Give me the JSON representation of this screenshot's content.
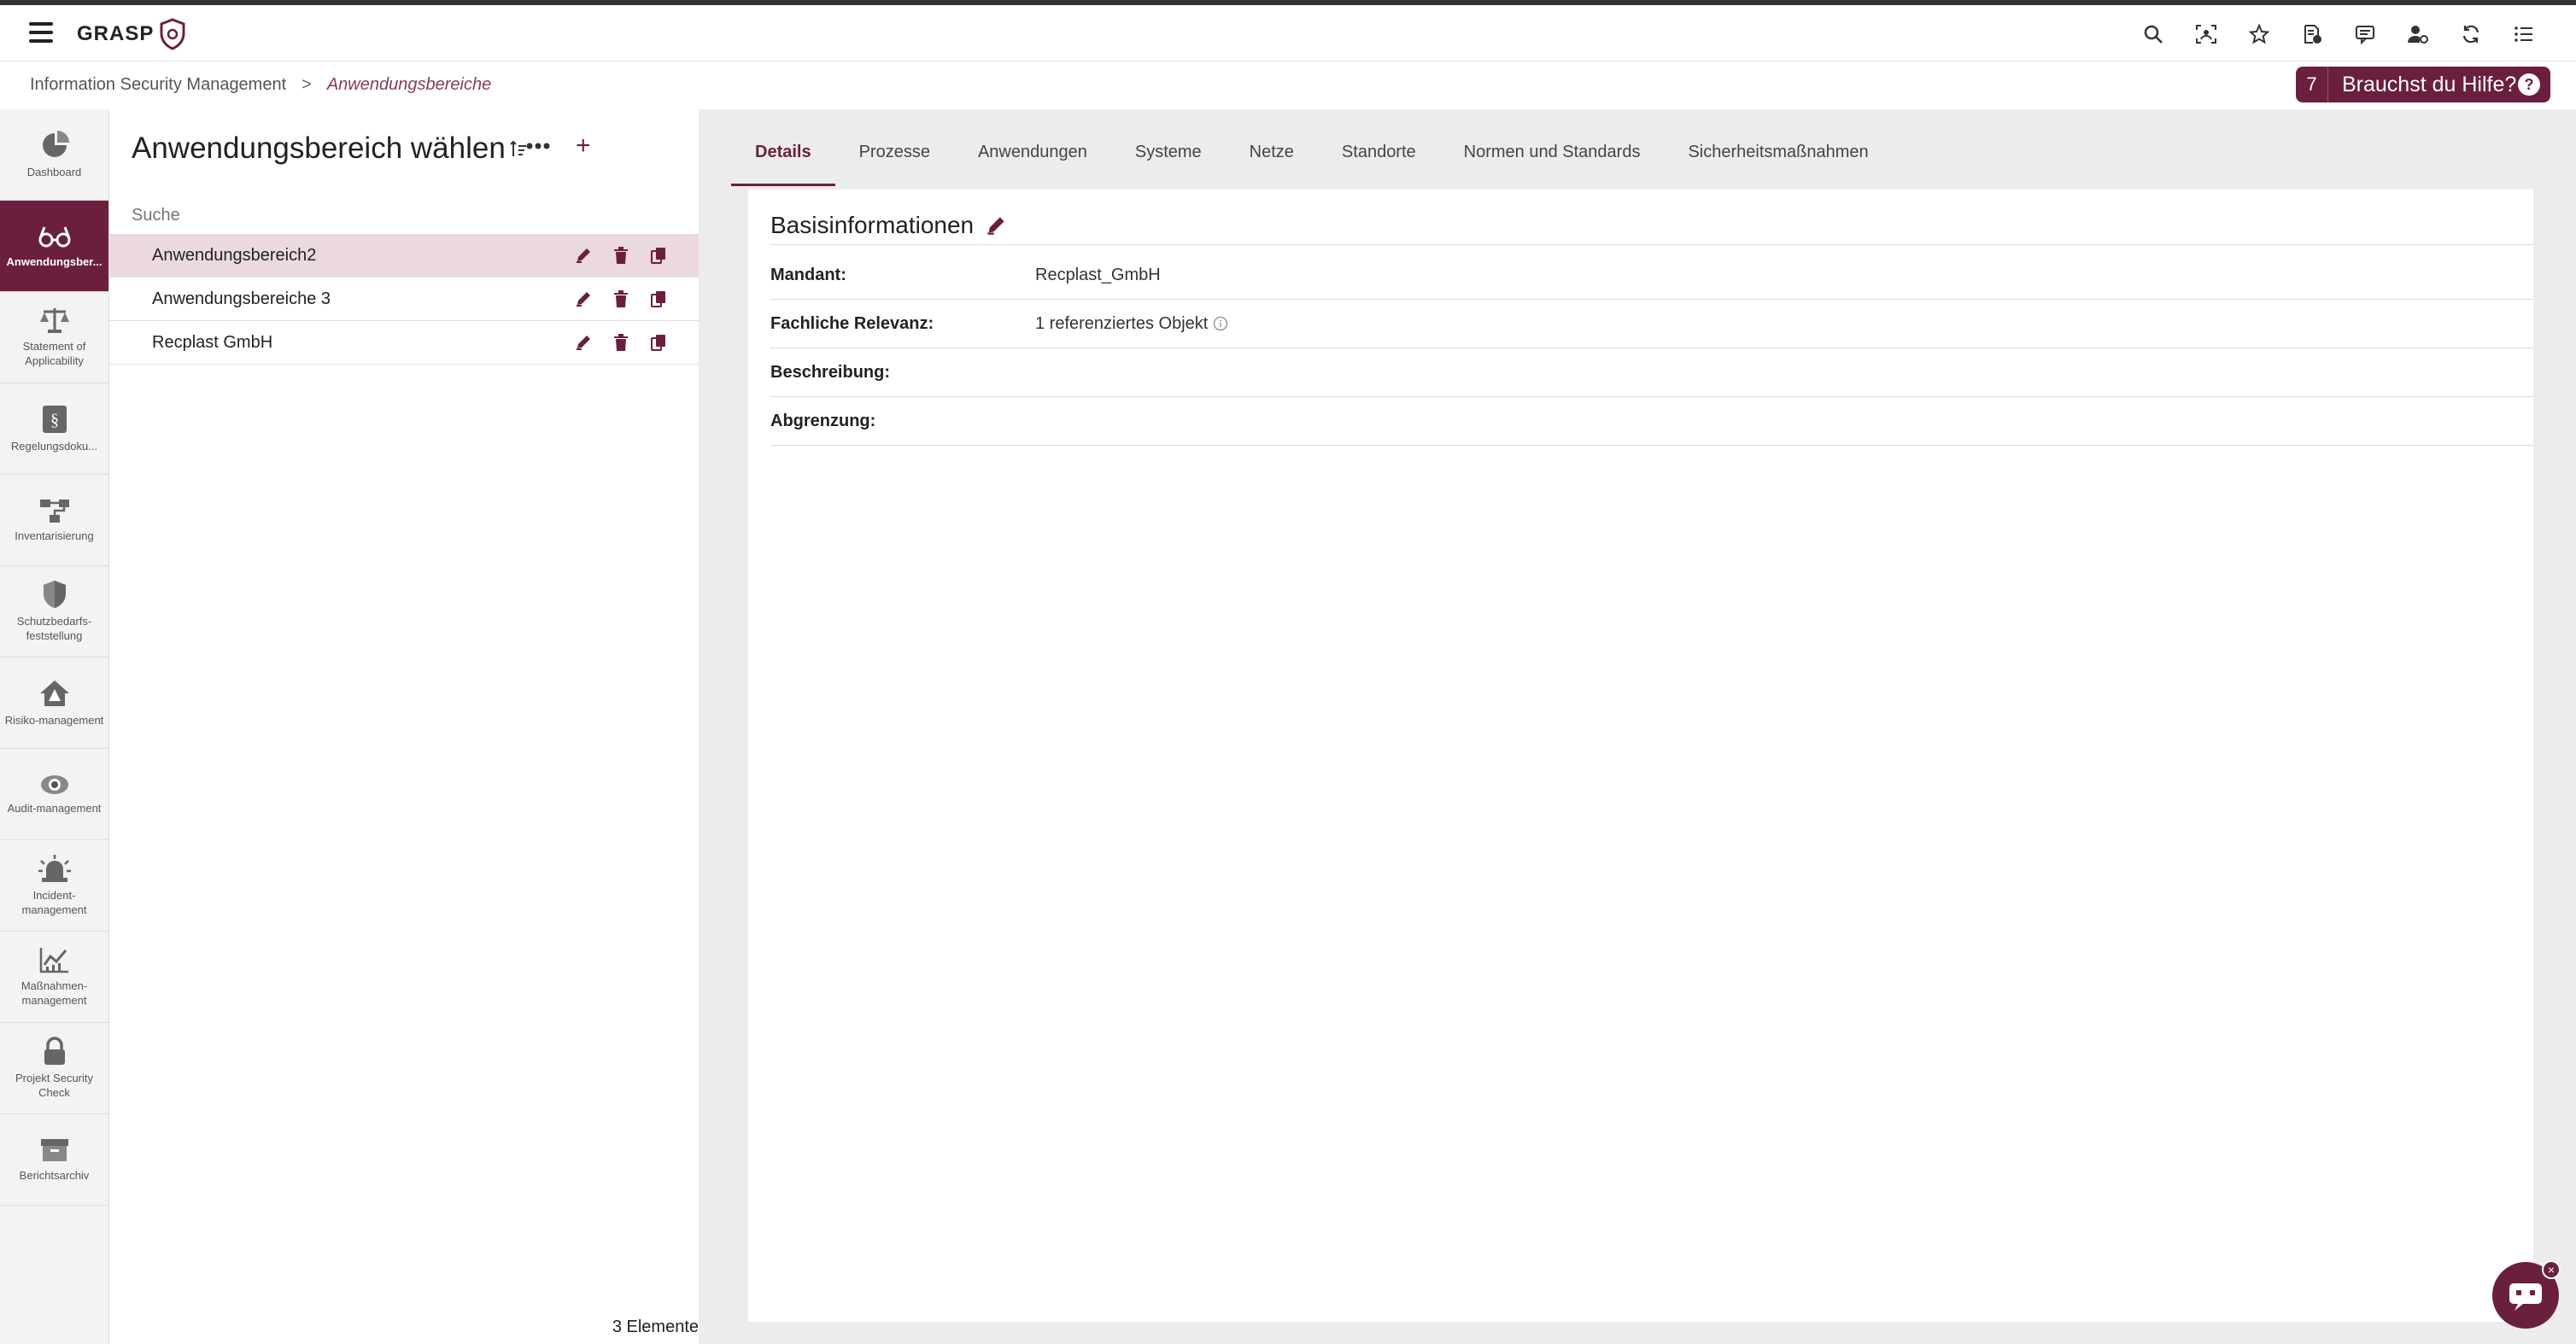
{
  "app": {
    "name": "GRASP"
  },
  "topbar": {
    "icons": [
      "search-icon",
      "face-scan-icon",
      "star-icon",
      "document-info-icon",
      "chat-icon",
      "user-settings-icon",
      "sync-icon",
      "list-icon"
    ]
  },
  "breadcrumb": {
    "root": "Information Security Management",
    "separator": ">",
    "current": "Anwendungsbereiche"
  },
  "help": {
    "count": "7",
    "label": "Brauchst du Hilfe?"
  },
  "sidebar": {
    "items": [
      {
        "label": "Dashboard",
        "icon": "pie-chart-icon"
      },
      {
        "label": "Anwendungsber...",
        "icon": "glasses-icon",
        "active": true
      },
      {
        "label": "Statement of Applicability",
        "icon": "scales-icon"
      },
      {
        "label": "Regelungsdoku...",
        "icon": "paragraph-icon"
      },
      {
        "label": "Inventarisierung",
        "icon": "network-icon"
      },
      {
        "label": "Schutzbedarfs-feststellung",
        "icon": "shield-icon"
      },
      {
        "label": "Risiko-management",
        "icon": "house-risk-icon"
      },
      {
        "label": "Audit-management",
        "icon": "eye-icon"
      },
      {
        "label": "Incident-management",
        "icon": "alarm-light-icon"
      },
      {
        "label": "Maßnahmen-management",
        "icon": "chart-line-icon"
      },
      {
        "label": "Projekt Security Check",
        "icon": "lock-icon"
      },
      {
        "label": "Berichtsarchiv",
        "icon": "archive-icon"
      }
    ]
  },
  "list": {
    "title": "Anwendungsbereich wählen",
    "search_placeholder": "Suche",
    "items": [
      {
        "label": "Anwendungsbereich2",
        "selected": true
      },
      {
        "label": "Anwendungsbereiche 3"
      },
      {
        "label": "Recplast GmbH"
      }
    ],
    "footer": "3 Elemente"
  },
  "tabs": [
    "Details",
    "Prozesse",
    "Anwendungen",
    "Systeme",
    "Netze",
    "Standorte",
    "Normen und Standards",
    "Sicherheitsmaßnahmen"
  ],
  "details": {
    "section_title": "Basisinformationen",
    "fields": [
      {
        "label": "Mandant:",
        "value": "Recplast_GmbH"
      },
      {
        "label": "Fachliche Relevanz:",
        "value": "1 referenziertes Objekt"
      },
      {
        "label": "Beschreibung:",
        "value": ""
      },
      {
        "label": "Abgrenzung:",
        "value": ""
      }
    ]
  },
  "colors": {
    "accent": "#6b1f3e",
    "selected_row": "#ebd9df"
  }
}
